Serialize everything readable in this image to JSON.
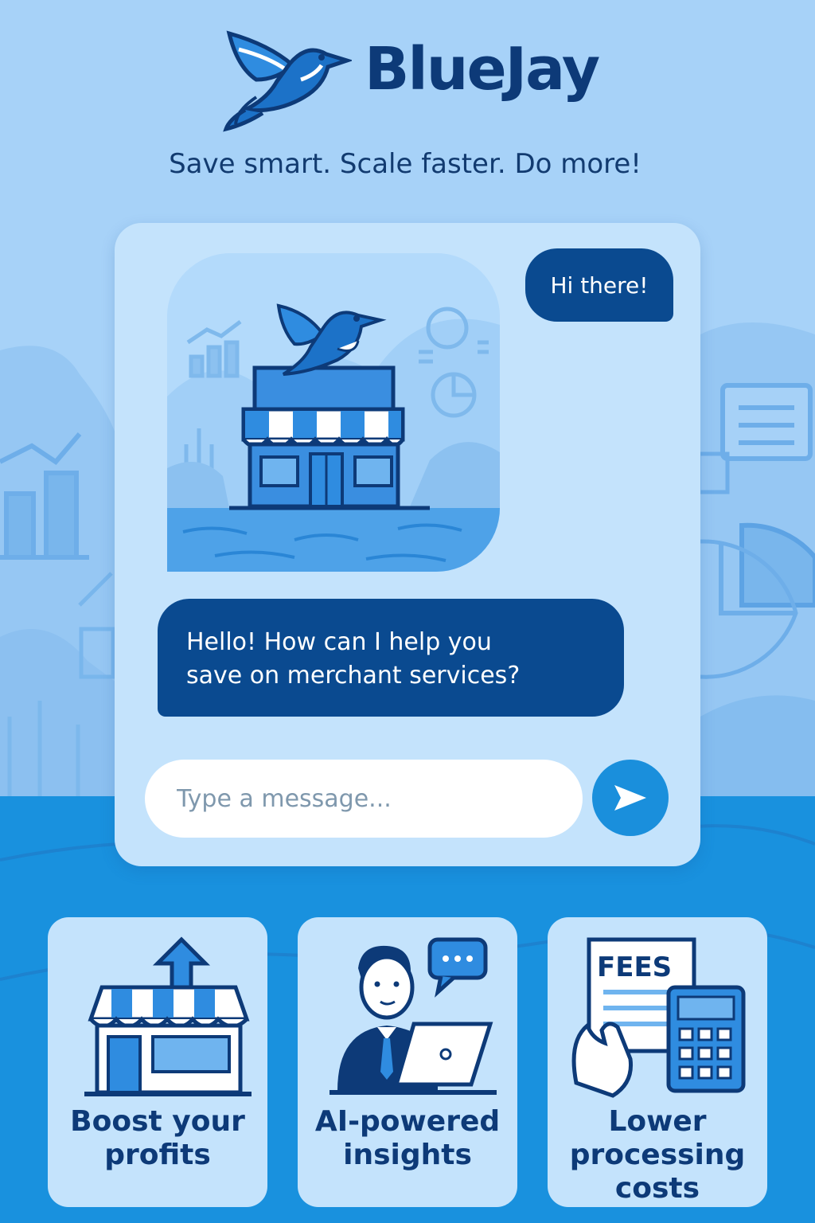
{
  "brand": {
    "name": "BlueJay",
    "tagline": "Save smart. Scale faster. Do more!"
  },
  "chat": {
    "user_message": "Hi there!",
    "bot_message": "Hello! How can I help you\nsave on merchant services?",
    "input_placeholder": "Type a message...",
    "send_icon": "send-icon"
  },
  "features": [
    {
      "label": "Boost your\nprofits",
      "icon": "storefront-growth-icon"
    },
    {
      "label": "AI-powered\ninsights",
      "icon": "advisor-laptop-icon"
    },
    {
      "label": "Lower\nprocessing\ncosts",
      "icon": "fees-calculator-icon"
    }
  ],
  "colors": {
    "navy": "#0d3a78",
    "bubble": "#0a4a90",
    "accent": "#1a8fdc",
    "sky": "#a7d2f8",
    "card": "#c4e3fc"
  }
}
